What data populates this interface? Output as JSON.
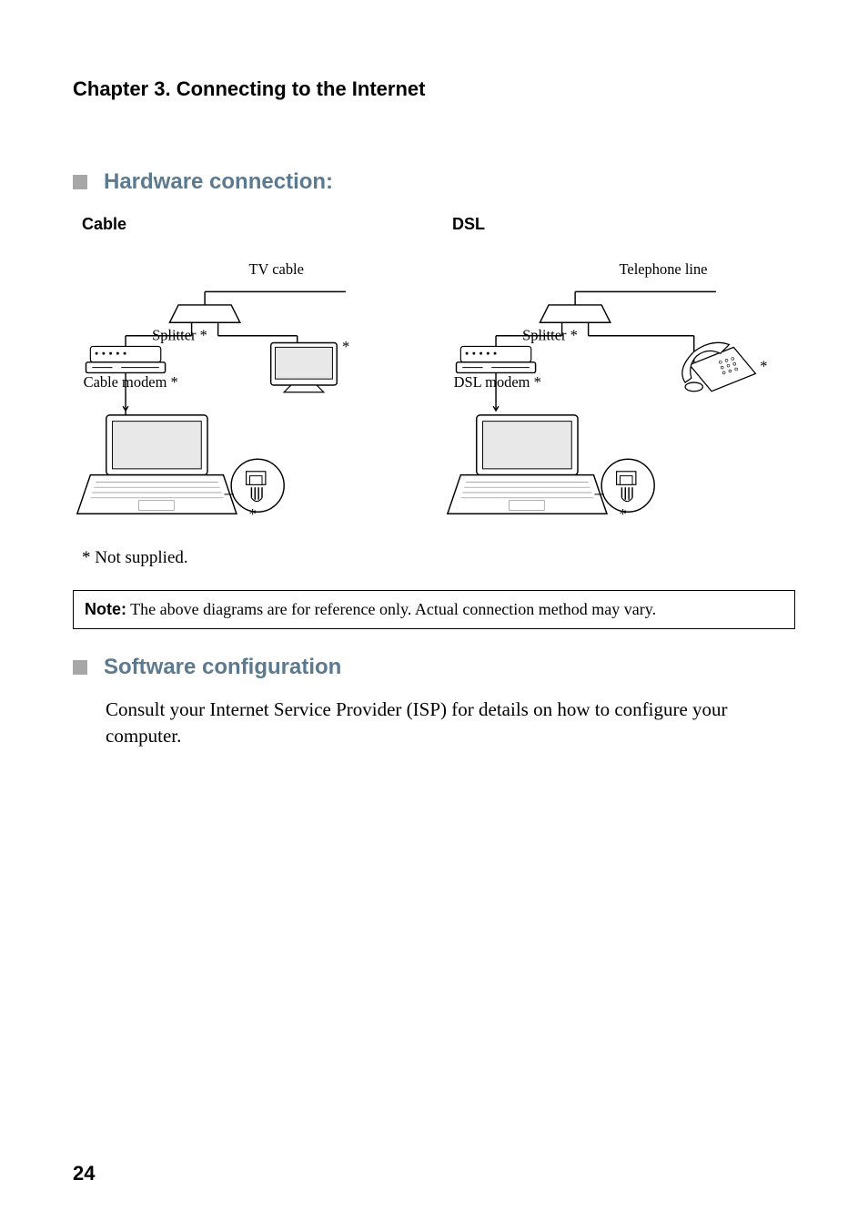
{
  "chapter_title": "Chapter 3. Connecting to the Internet",
  "sections": {
    "hardware": {
      "heading": "Hardware connection:",
      "cable": {
        "title": "Cable",
        "top_label": "TV cable",
        "splitter": "Splitter *",
        "modem": "Cable modem *",
        "tv_ast": "*",
        "port_ast": "*"
      },
      "dsl": {
        "title": "DSL",
        "top_label": "Telephone line",
        "splitter": "Splitter *",
        "modem": "DSL modem *",
        "phone_ast": "*",
        "port_ast": "*"
      },
      "footnote": "* Not supplied.",
      "note_label": "Note:",
      "note_text": " The above diagrams are for reference only. Actual connection method may vary."
    },
    "software": {
      "heading": "Software configuration",
      "body": "Consult your Internet Service Provider (ISP) for details on how to configure your computer."
    }
  },
  "page_number": "24"
}
